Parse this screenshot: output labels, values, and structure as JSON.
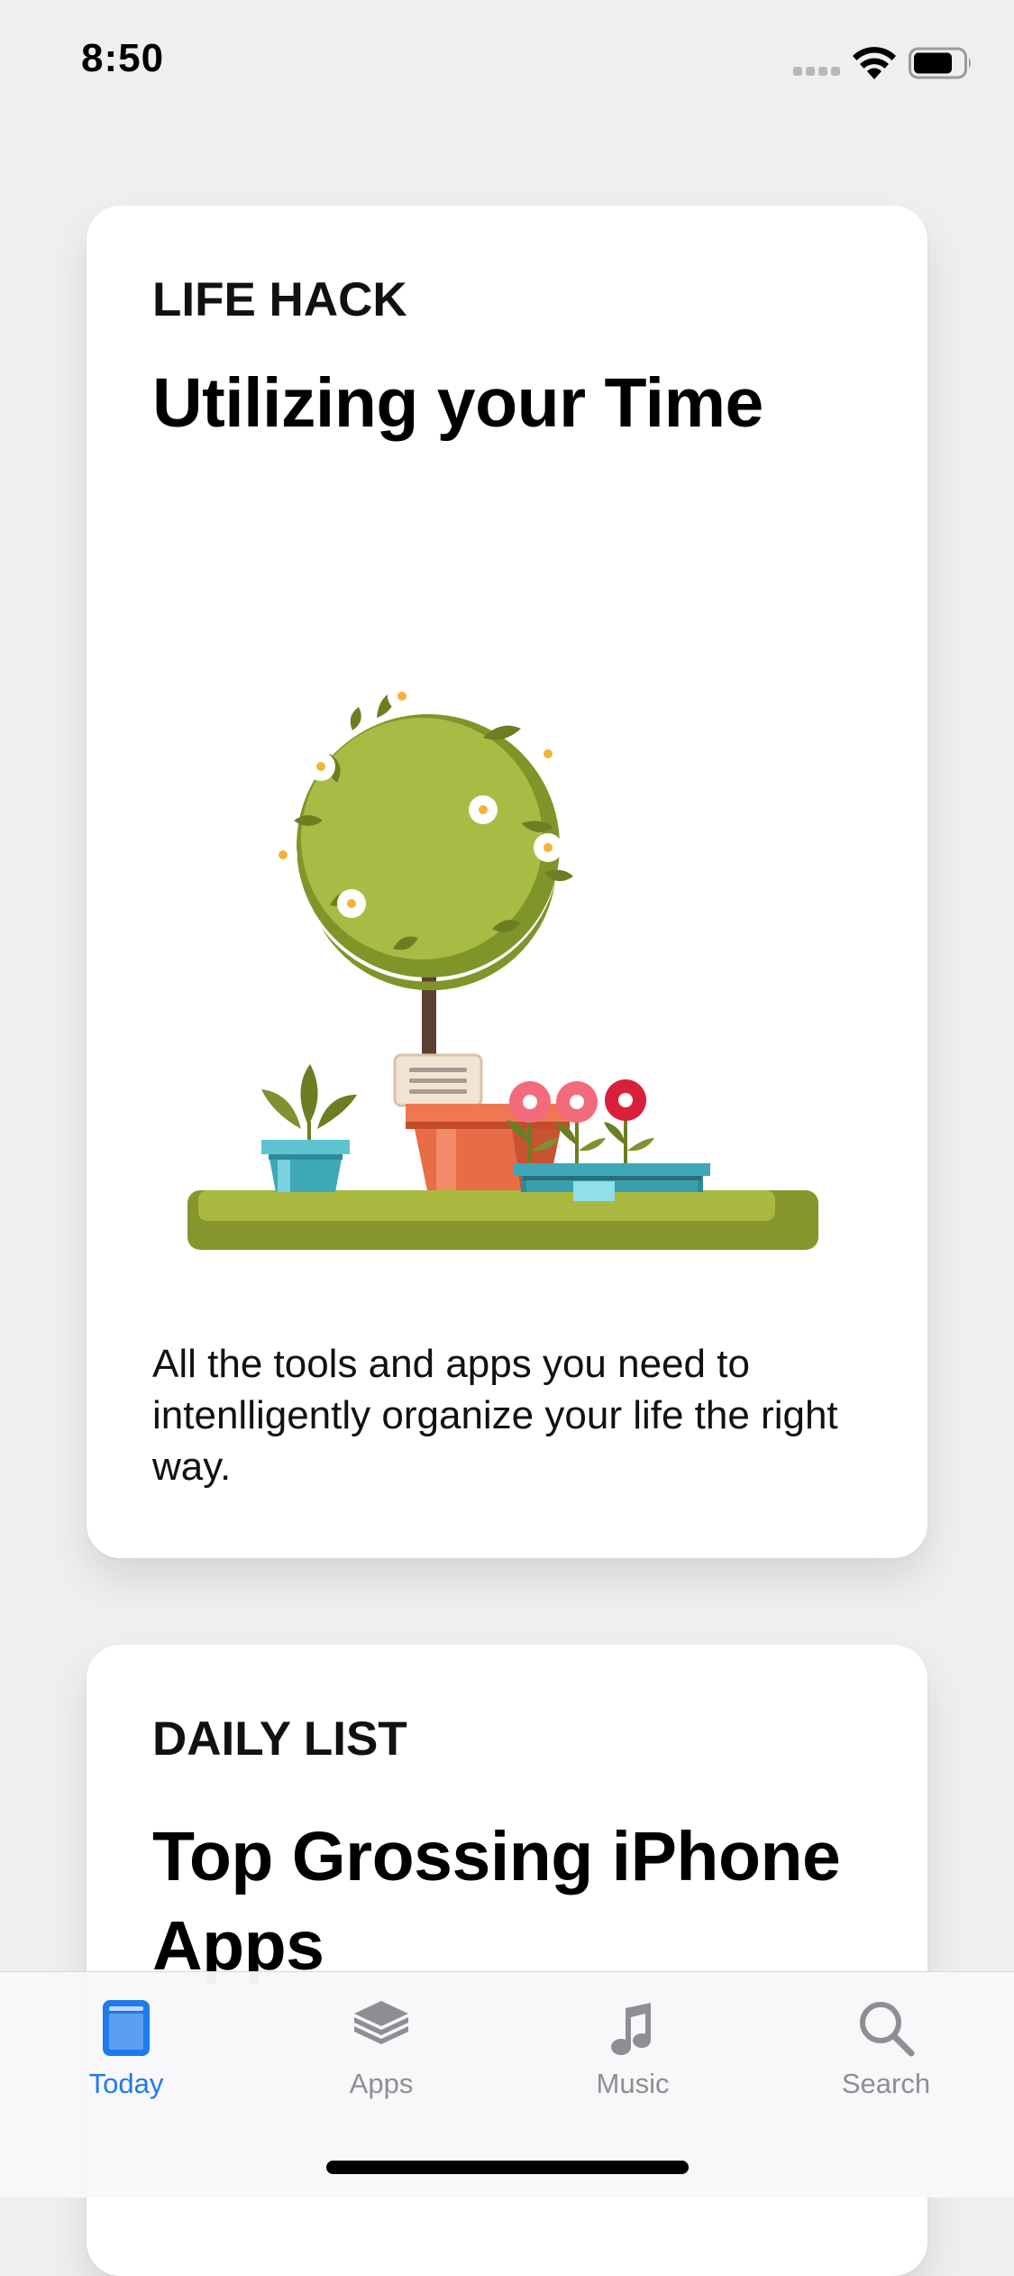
{
  "status_bar": {
    "time": "8:50"
  },
  "cards": [
    {
      "eyebrow": "LIFE HACK",
      "title": "Utilizing your Time",
      "body": "All the tools and apps you need to intenlligently organize your life the right way."
    },
    {
      "eyebrow": "DAILY LIST",
      "title": "Top Grossing iPhone Apps"
    }
  ],
  "tab_bar": {
    "items": [
      {
        "label": "Today",
        "icon": "today-icon",
        "selected": true
      },
      {
        "label": "Apps",
        "icon": "apps-stack-icon",
        "selected": false
      },
      {
        "label": "Music",
        "icon": "music-note-icon",
        "selected": false
      },
      {
        "label": "Search",
        "icon": "search-icon",
        "selected": false
      }
    ]
  },
  "colors": {
    "accent": "#1e7bea",
    "inactive": "#8e8e93",
    "background": "#efeff1"
  }
}
